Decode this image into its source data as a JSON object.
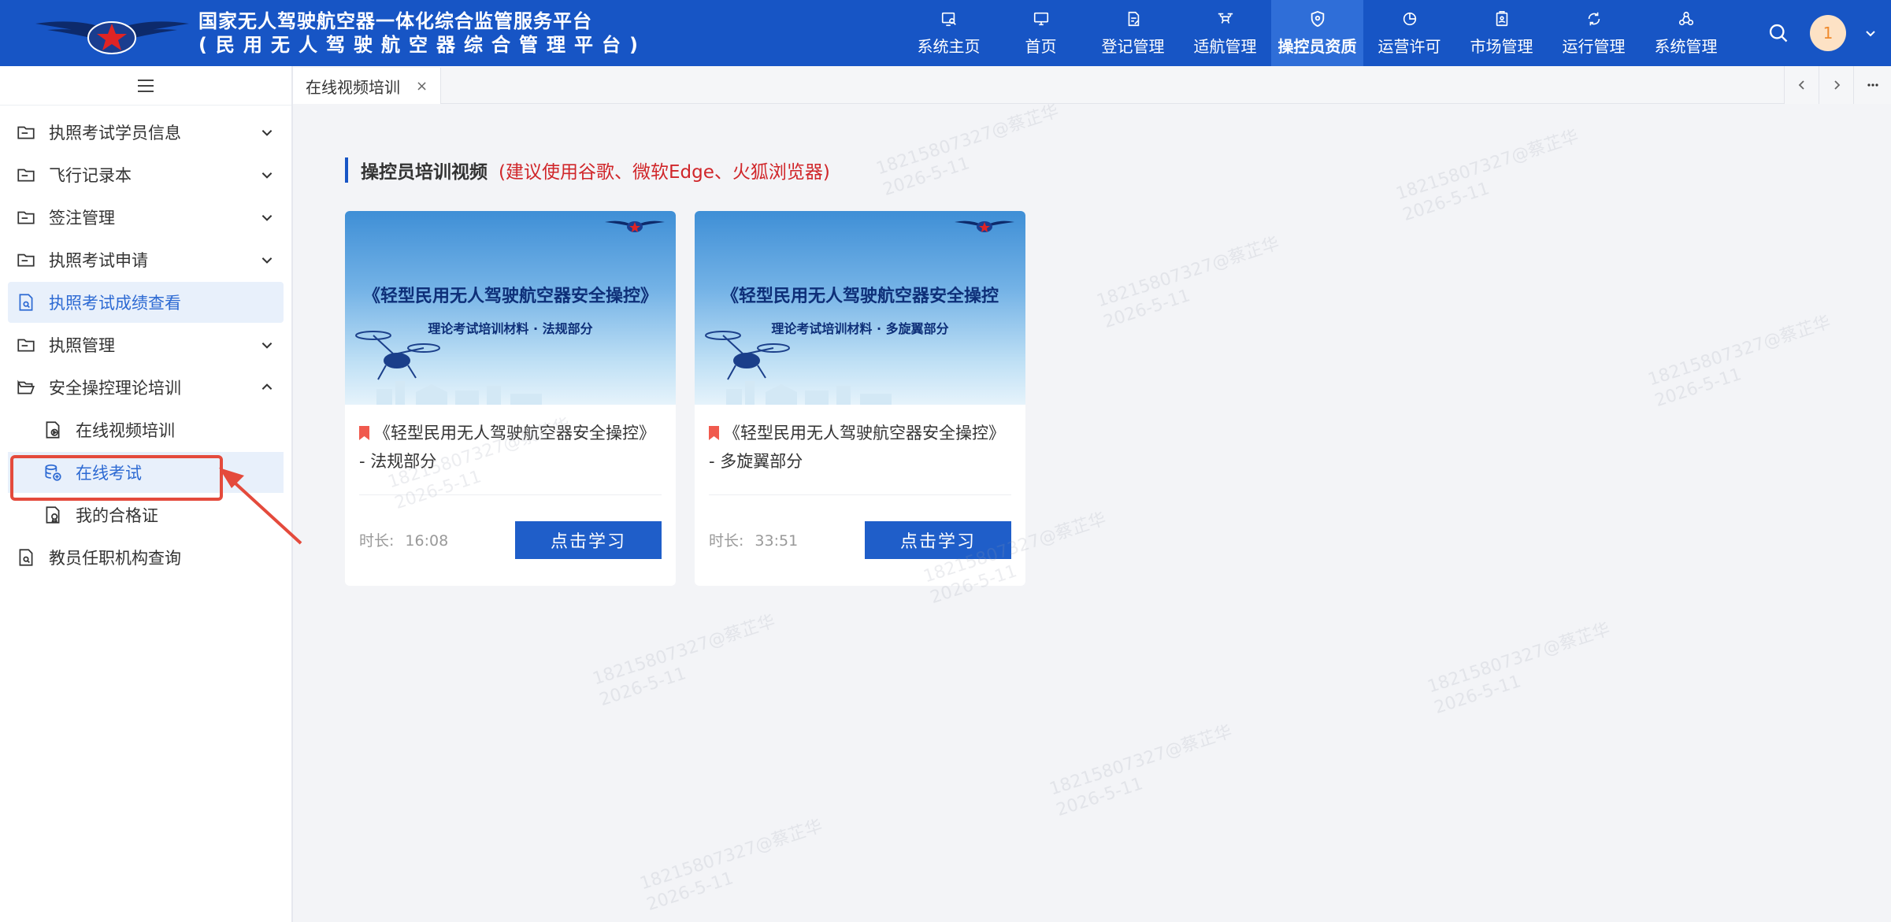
{
  "header": {
    "title_line1": "国家无人驾驶航空器一体化综合监管服务平台",
    "title_line2": "(民用无人驾驶航空器综合管理平台)",
    "nav": [
      {
        "label": "系统主页",
        "icon": "monitor-search-icon"
      },
      {
        "label": "首页",
        "icon": "desktop-icon"
      },
      {
        "label": "登记管理",
        "icon": "document-edit-icon"
      },
      {
        "label": "适航管理",
        "icon": "drone-icon"
      },
      {
        "label": "操控员资质",
        "icon": "shield-icon",
        "active": true
      },
      {
        "label": "运营许可",
        "icon": "chart-ring-icon"
      },
      {
        "label": "市场管理",
        "icon": "badge-icon"
      },
      {
        "label": "运行管理",
        "icon": "refresh-icon"
      },
      {
        "label": "系统管理",
        "icon": "network-icon"
      }
    ],
    "avatar_text": "1",
    "colors": {
      "header_bg": "#1755c5",
      "active_nav": "#2f6ed8"
    }
  },
  "sidebar": {
    "items": [
      {
        "label": "执照考试学员信息",
        "expanded": false
      },
      {
        "label": "飞行记录本",
        "expanded": false
      },
      {
        "label": "签注管理",
        "expanded": false
      },
      {
        "label": "执照考试申请",
        "expanded": false
      },
      {
        "label": "执照考试成绩查看",
        "selected": true
      },
      {
        "label": "执照管理",
        "expanded": false
      },
      {
        "label": "安全操控理论培训",
        "expanded": true
      },
      {
        "label": "在线视频培训",
        "sub": true
      },
      {
        "label": "在线考试",
        "sub": true,
        "highlight": true
      },
      {
        "label": "我的合格证",
        "sub": true
      },
      {
        "label": "教员任职机构查询"
      }
    ]
  },
  "tabs": [
    {
      "label": "在线视频培训",
      "close": "×"
    }
  ],
  "content": {
    "section_title": "操控员培训视频",
    "section_note": "(建议使用谷歌、微软Edge、火狐浏览器)",
    "cards": [
      {
        "thumb_title": "《轻型民用无人驾驶航空器安全操控》",
        "thumb_subtitle": "理论考试培训材料 · 法规部分",
        "title": "《轻型民用无人驾驶航空器安全操控》 - 法规部分",
        "duration_label": "时长:",
        "duration": "16:08",
        "button": "点击学习"
      },
      {
        "thumb_title": "《轻型民用无人驾驶航空器安全操控",
        "thumb_subtitle": "理论考试培训材料 · 多旋翼部分",
        "title": "《轻型民用无人驾驶航空器安全操控》 - 多旋翼部分",
        "duration_label": "时长:",
        "duration": "33:51",
        "button": "点击学习"
      }
    ]
  },
  "watermark": {
    "line1": "18215807327@蔡芷华",
    "line2": "2026-5-11"
  }
}
